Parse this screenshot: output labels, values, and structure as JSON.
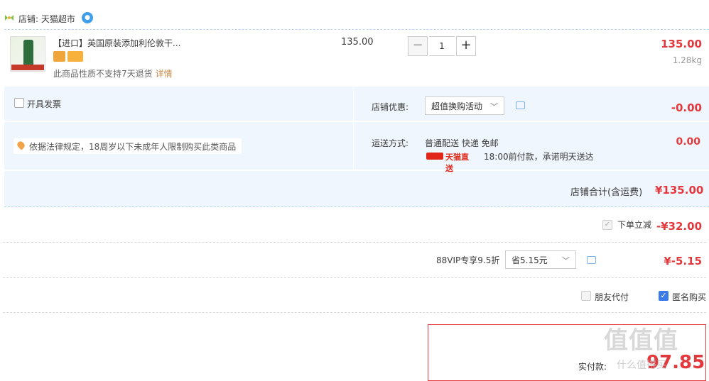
{
  "shop": {
    "label": "店铺: 天猫超市",
    "badge": "💬"
  },
  "item": {
    "title": "【进口】英国原装添加利伦敦干...",
    "return_note": "此商品性质不支持7天退货",
    "return_link": "详情",
    "unit_price": "135.00",
    "quantity": "1",
    "minus": "−",
    "plus": "+",
    "total": "135.00",
    "weight": "1.28kg"
  },
  "options": {
    "invoice_label": "开具发票",
    "shop_discount_label": "店铺优惠:",
    "promo_select": "超值换购活动",
    "shop_discount_amount": "-0.00",
    "law_note": "依据法律规定，18周岁以下未成年人限制购买此类商品",
    "shipping_label": "运送方式:",
    "shipping_method": "普通配送 快递 免邮",
    "tmall_direct": "天猫直送",
    "shipping_promise": "18:00前付款，承诺明天送达",
    "shipping_fee": "0.00",
    "shop_total_label": "店铺合计(含运费)",
    "shop_total": "¥135.00"
  },
  "order": {
    "instant_label": "下单立减",
    "instant_amount": "-¥32.00",
    "vip_label": "88VIP专享9.5折",
    "vip_select": "省5.15元",
    "vip_amount": "¥-5.15",
    "friend_label": "朋友代付",
    "anon_label": "匿名购买",
    "pay_label": "实付款:",
    "pay_amount": "97.85"
  },
  "watermark": {
    "main": "值值值",
    "sub": "什么值得买"
  },
  "colors": {
    "price_red": "#e4393c",
    "panel_blue": "#eff6fd",
    "accent_blue": "#3b7be8"
  }
}
